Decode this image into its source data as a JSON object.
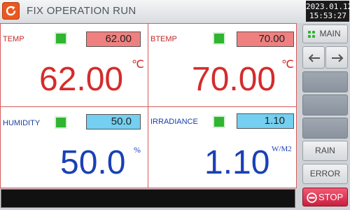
{
  "header": {
    "title": "FIX OPERATION RUN",
    "date": "2023.01.12",
    "time": "15:53:27"
  },
  "cells": {
    "temp": {
      "label": "TEMP",
      "set_value": "62.00",
      "current_value": "62.00",
      "unit": "℃"
    },
    "btemp": {
      "label": "BTEMP",
      "set_value": "70.00",
      "current_value": "70.00",
      "unit": "℃"
    },
    "humidity": {
      "label": "HUMIDITY",
      "set_value": "50.0",
      "current_value": "50.0",
      "unit": "%"
    },
    "irradiance": {
      "label": "IRRADIANCE",
      "set_value": "1.10",
      "current_value": "1.10",
      "unit": "W/M2"
    }
  },
  "sidebar": {
    "main_label": "MAIN",
    "rain_label": "RAIN",
    "error_label": "ERROR",
    "stop_label": "STOP"
  },
  "icons": [
    "refresh-icon",
    "grid-icon",
    "arrow-left-icon",
    "arrow-right-icon",
    "stop-icon"
  ],
  "colors": {
    "accent_orange": "#e9581f",
    "value_red": "#d42c2c",
    "value_blue": "#1941b6",
    "indicator_green": "#2fb52f",
    "stop_red": "#d8304f"
  }
}
